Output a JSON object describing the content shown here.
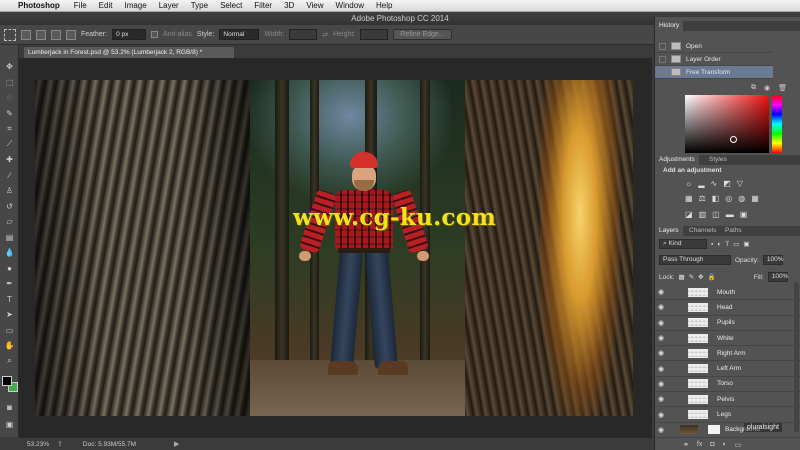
{
  "menubar": {
    "app": "Photoshop",
    "items": [
      "File",
      "Edit",
      "Image",
      "Layer",
      "Type",
      "Select",
      "Filter",
      "3D",
      "View",
      "Window",
      "Help"
    ]
  },
  "window": {
    "title": "Adobe Photoshop CC 2014"
  },
  "options": {
    "feather_label": "Feather:",
    "feather_value": "0 px",
    "antialias_label": "Anti-alias",
    "style_label": "Style:",
    "style_value": "Normal",
    "width_label": "Width:",
    "height_label": "Height:",
    "refine_edge": "Refine Edge..."
  },
  "document": {
    "tab_title": "Lumberjack in Forest.psd @ 53.2% (Lumberjack 2, RGB/8) *"
  },
  "watermark": "www.cg-ku.com",
  "statusbar": {
    "zoom": "53.23%",
    "doc": "Doc: 5.93M/55.7M"
  },
  "history": {
    "tab": "History",
    "items": [
      {
        "label": "Open",
        "selected": false
      },
      {
        "label": "Layer Order",
        "selected": false
      },
      {
        "label": "Free Transform",
        "selected": true
      }
    ]
  },
  "adjustments": {
    "tabs": [
      "Adjustments",
      "Styles"
    ],
    "title": "Add an adjustment"
  },
  "layers": {
    "tabs": [
      "Layers",
      "Channels",
      "Paths"
    ],
    "kind_label": "Kind",
    "blend_mode": "Pass Through",
    "opacity_label": "Opacity:",
    "opacity_value": "100%",
    "lock_label": "Lock:",
    "fill_label": "Fill:",
    "fill_value": "100%",
    "rows": [
      "Mouth",
      "Head",
      "Pupils",
      "White",
      "Right Arm",
      "Left Arm",
      "Torso",
      "Pelvis",
      "Legs"
    ],
    "background_label": "Background"
  },
  "brand": "pluralsight",
  "colors": {
    "selection": "#6a7a95",
    "background_swatch": "#3fae49",
    "foreground_swatch": "#000000"
  }
}
